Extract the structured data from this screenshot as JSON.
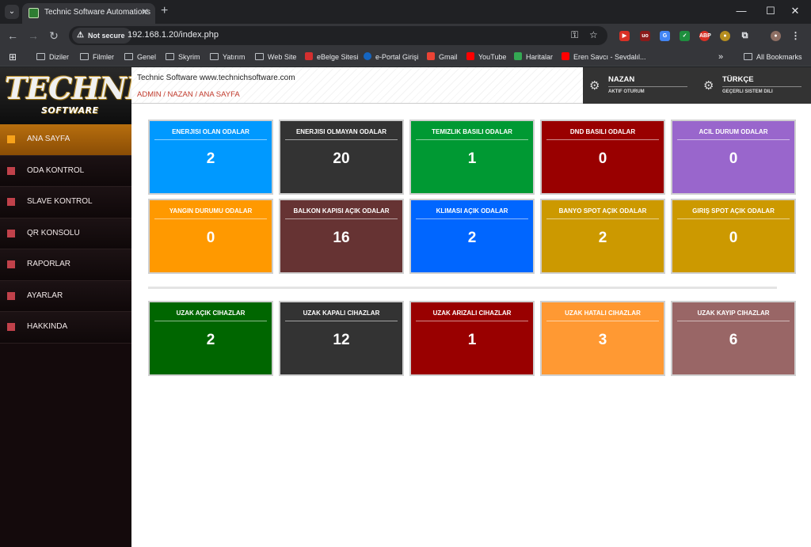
{
  "browser": {
    "tab_title": "Technic Software Automations",
    "not_secure": "Not secure",
    "url": "192.168.1.20/index.php",
    "bookmarks": [
      {
        "label": "Diziler"
      },
      {
        "label": "Filmler"
      },
      {
        "label": "Genel"
      },
      {
        "label": "Skyrim"
      },
      {
        "label": "Yatırım"
      },
      {
        "label": "Web Site"
      },
      {
        "label": "eBelge Sitesi"
      },
      {
        "label": "e-Portal Girişi"
      },
      {
        "label": "Gmail"
      },
      {
        "label": "YouTube"
      },
      {
        "label": "Haritalar"
      },
      {
        "label": "Eren Savcı - Sevdalıl..."
      }
    ],
    "all_bookmarks": "All Bookmarks"
  },
  "logo": {
    "main": "TECHNIC",
    "sub": "SOFTWARE"
  },
  "sidebar": {
    "items": [
      {
        "label": "ANA SAYFA",
        "active": true
      },
      {
        "label": "ODA KONTROL"
      },
      {
        "label": "SLAVE KONTROL"
      },
      {
        "label": "QR KONSOLU"
      },
      {
        "label": "RAPORLAR"
      },
      {
        "label": "AYARLAR"
      },
      {
        "label": "HAKKINDA"
      }
    ]
  },
  "header": {
    "site": "Technic Software www.technichsoftware.com",
    "breadcrumb": "ADMIN / NAZAN / ANA SAYFA",
    "user": {
      "name": "NAZAN",
      "sub": "AKTIF OTURUM"
    },
    "lang": {
      "name": "TÜRKÇE",
      "sub": "GEÇERLI SISTEM DILI"
    }
  },
  "cards": [
    {
      "title": "ENERJISI OLAN ODALAR",
      "value": "2",
      "color": "#0099ff"
    },
    {
      "title": "ENERJISI OLMAYAN ODALAR",
      "value": "20",
      "color": "#333333"
    },
    {
      "title": "TEMIZLIK BASILI ODALAR",
      "value": "1",
      "color": "#009933"
    },
    {
      "title": "DND BASILI ODALAR",
      "value": "0",
      "color": "#990000"
    },
    {
      "title": "ACIL DURUM ODALAR",
      "value": "0",
      "color": "#9966cc"
    },
    {
      "title": "YANGIN DURUMU ODALAR",
      "value": "0",
      "color": "#ff9900"
    },
    {
      "title": "BALKON KAPISI AÇIK ODALAR",
      "value": "16",
      "color": "#663333"
    },
    {
      "title": "KLIMASI AÇIK ODALAR",
      "value": "2",
      "color": "#0066ff"
    },
    {
      "title": "BANYO SPOT AÇIK ODALAR",
      "value": "2",
      "color": "#cc9900"
    },
    {
      "title": "GIRIŞ SPOT AÇIK ODALAR",
      "value": "0",
      "color": "#cc9900"
    },
    {
      "title": "UZAK AÇIK CIHAZLAR",
      "value": "2",
      "color": "#006600"
    },
    {
      "title": "UZAK KAPALI CIHAZLAR",
      "value": "12",
      "color": "#333333"
    },
    {
      "title": "UZAK ARIZALI CIHAZLAR",
      "value": "1",
      "color": "#990000"
    },
    {
      "title": "UZAK HATALI CIHAZLAR",
      "value": "3",
      "color": "#ff9933"
    },
    {
      "title": "UZAK KAYIP CIHAZLAR",
      "value": "6",
      "color": "#996666"
    }
  ]
}
